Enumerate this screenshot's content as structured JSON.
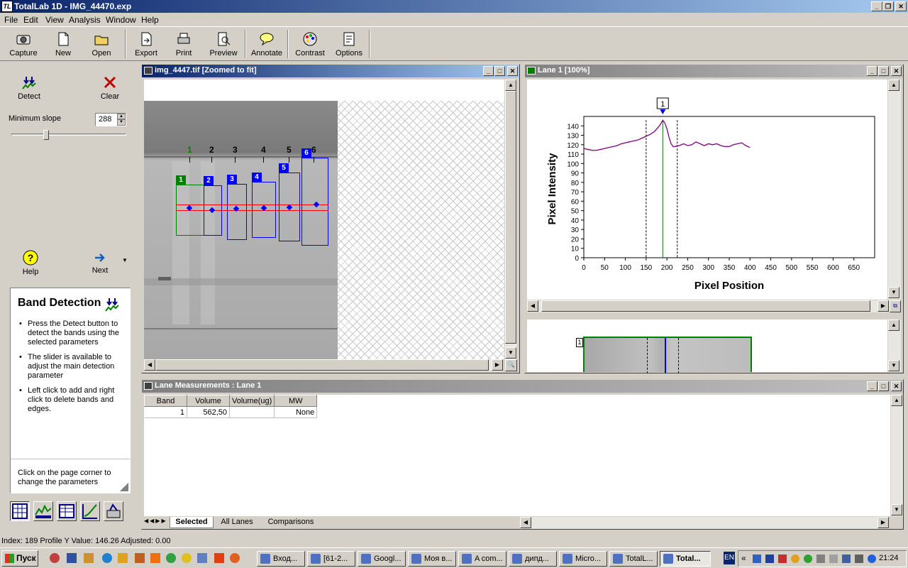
{
  "window": {
    "title": "TotalLab 1D - IMG_44470.exp",
    "app_icon": "TL"
  },
  "menu": [
    "File",
    "Edit",
    "View",
    "Analysis",
    "Window",
    "Help"
  ],
  "toolbar": [
    {
      "label": "Capture",
      "icon": "camera-icon"
    },
    {
      "label": "New",
      "icon": "new-file-icon"
    },
    {
      "label": "Open",
      "icon": "open-folder-icon"
    },
    {
      "label": "Export",
      "icon": "export-icon"
    },
    {
      "label": "Print",
      "icon": "printer-icon"
    },
    {
      "label": "Preview",
      "icon": "preview-icon"
    },
    {
      "label": "Annotate",
      "icon": "speech-bubble-icon"
    },
    {
      "label": "Contrast",
      "icon": "palette-icon"
    },
    {
      "label": "Options",
      "icon": "options-icon"
    }
  ],
  "left": {
    "detect": "Detect",
    "clear": "Clear",
    "min_slope_label": "Minimum slope",
    "min_slope_value": "288",
    "help": "Help",
    "next": "Next",
    "panel_title": "Band Detection",
    "bullets": [
      "Press the Detect button to detect the bands using the selected parameters",
      "The slider is available to adjust the main detection parameter",
      "Left click to add and right click to delete bands and edges."
    ],
    "footer": "Click on the page corner to change the parameters"
  },
  "image_window": {
    "title": "img_4447.tif [Zoomed to fit]",
    "lanes": [
      "1",
      "2",
      "3",
      "4",
      "5",
      "6"
    ]
  },
  "lane_window": {
    "title": "Lane 1 [100%]",
    "marker": "1",
    "strip_label": "1"
  },
  "chart_data": {
    "type": "line",
    "xlabel": "Pixel Position",
    "ylabel": "Pixel Intensity",
    "xlim": [
      0,
      700
    ],
    "ylim": [
      0,
      150
    ],
    "xticks": [
      0,
      50,
      100,
      150,
      200,
      250,
      300,
      350,
      400,
      450,
      500,
      550,
      600,
      650
    ],
    "yticks": [
      0,
      10,
      20,
      30,
      40,
      50,
      60,
      70,
      80,
      90,
      100,
      110,
      120,
      130,
      140
    ],
    "x": [
      0,
      10,
      20,
      30,
      40,
      50,
      60,
      70,
      80,
      90,
      100,
      110,
      120,
      130,
      140,
      150,
      160,
      170,
      180,
      185,
      190,
      195,
      200,
      205,
      210,
      215,
      220,
      225,
      230,
      240,
      250,
      260,
      270,
      280,
      290,
      300,
      310,
      320,
      330,
      340,
      350,
      360,
      370,
      380,
      390,
      400
    ],
    "y": [
      116,
      115,
      114,
      114,
      115,
      116,
      117,
      118,
      119,
      121,
      122,
      123,
      124,
      125,
      127,
      129,
      131,
      134,
      139,
      142,
      146,
      143,
      137,
      128,
      121,
      118,
      118,
      119,
      119,
      121,
      119,
      120,
      123,
      121,
      119,
      121,
      120,
      121,
      119,
      118,
      118,
      120,
      121,
      122,
      119,
      117
    ],
    "peak_x": 190,
    "edge_left": 150,
    "edge_right": 225,
    "line_color": "#800080"
  },
  "measurements": {
    "title": "Lane Measurements : Lane 1",
    "columns": [
      "Band",
      "Volume",
      "Volume(ug)",
      "MW"
    ],
    "rows": [
      [
        "1",
        "562,50",
        "",
        "None"
      ]
    ],
    "tabs": [
      "Selected",
      "All Lanes",
      "Comparisons"
    ]
  },
  "status": "Index: 189 Profile Y Value: 146.26 Adjusted: 0.00",
  "taskbar": {
    "start": "Пуск",
    "tasks": [
      "Вход...",
      "[61-2...",
      "Googl...",
      "Моя в...",
      "A com...",
      "дипд...",
      "Micro...",
      "TotalL...",
      "Total..."
    ],
    "lang": "EN",
    "clock": "21:24"
  }
}
